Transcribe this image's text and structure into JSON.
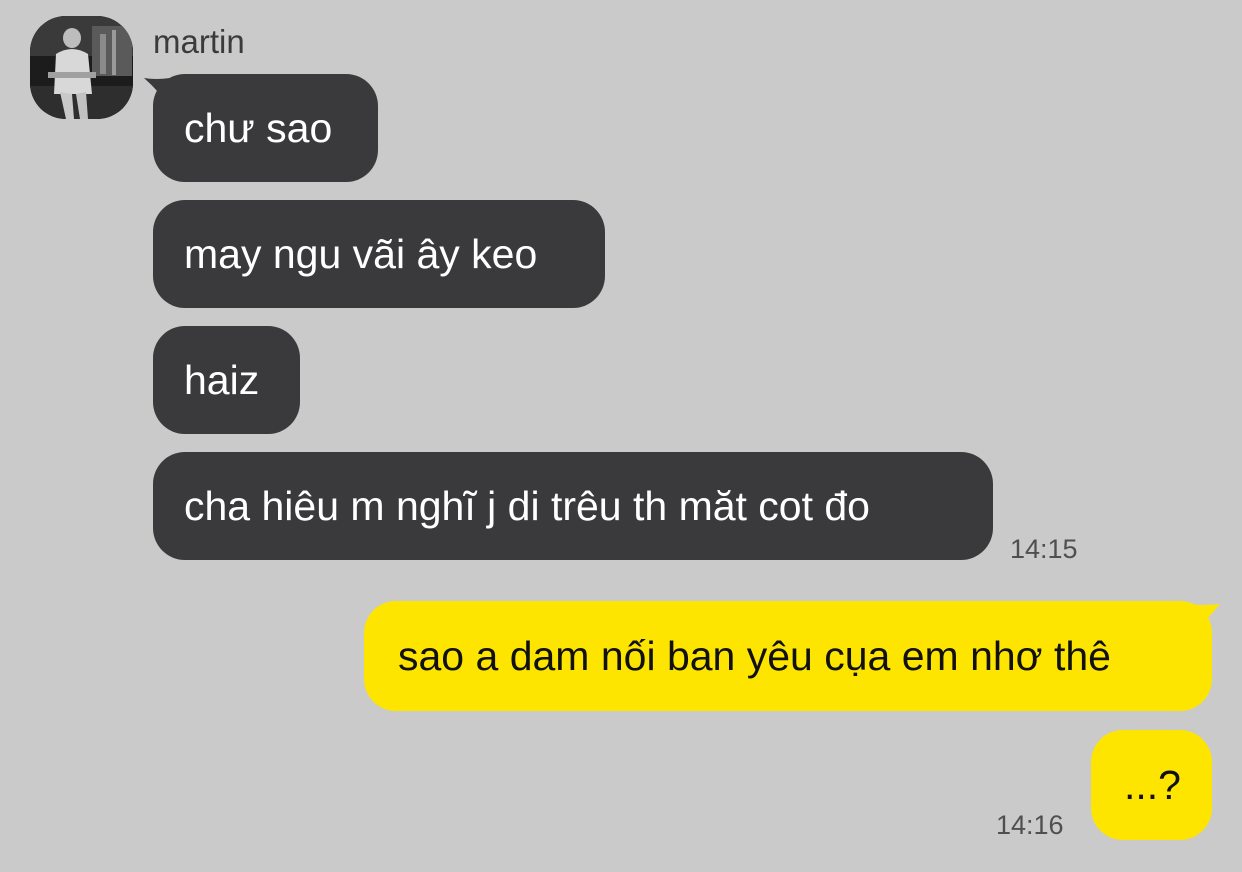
{
  "conversation": {
    "incoming": {
      "sender_name": "martin",
      "messages": [
        "chư sao",
        "may ngu vãi ây keo",
        "haiz",
        "cha hiêu m nghĩ j di trêu th măt cot đo"
      ],
      "time": "14:15"
    },
    "outgoing": {
      "messages": [
        "sao a dam nối ban yêu cụa em nhơ thê",
        "...?"
      ],
      "time": "14:16"
    }
  },
  "colors": {
    "background": "#cacaca",
    "incoming_bubble": "#3a3a3c",
    "outgoing_bubble": "#fee500"
  },
  "icons": {
    "avatar": "user-avatar-photo"
  }
}
